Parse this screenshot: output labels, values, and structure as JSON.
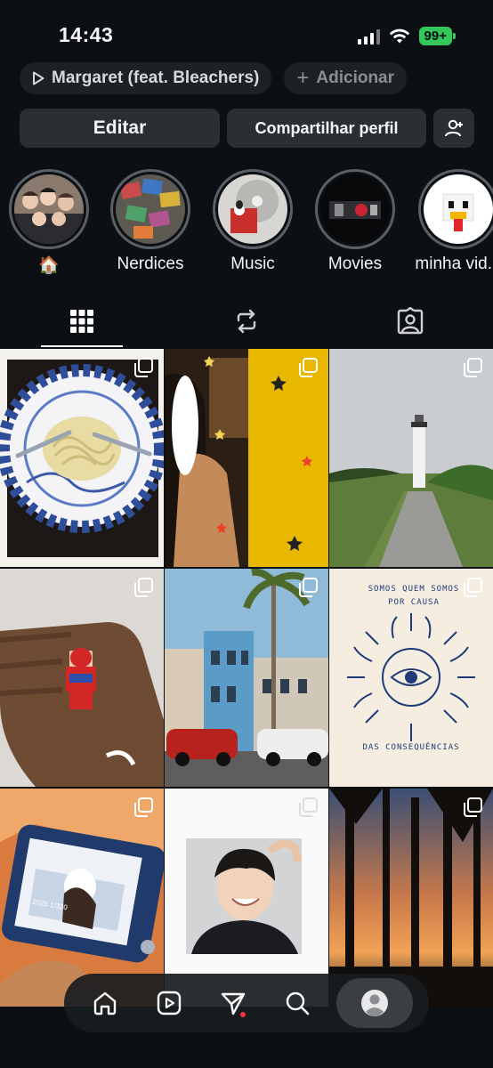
{
  "status_bar": {
    "time": "14:43",
    "battery": "99+"
  },
  "music_chip": {
    "label": "Margaret (feat. Bleachers)"
  },
  "add_chip": {
    "label": "Adicionar"
  },
  "buttons": {
    "edit": "Editar",
    "share": "Compartilhar perfil"
  },
  "highlights": [
    {
      "label": "🏠"
    },
    {
      "label": "Nerdices"
    },
    {
      "label": "Music"
    },
    {
      "label": "Movies"
    },
    {
      "label": "minha vid..."
    }
  ],
  "tabs": [
    "grid-icon",
    "reposts-icon",
    "tagged-icon"
  ],
  "posts": [
    {
      "text": ""
    },
    {
      "text": ""
    },
    {
      "text": ""
    },
    {
      "text": ""
    },
    {
      "text": ""
    },
    {
      "text": "SOMOS QUEM SOMOS POR CAUSA",
      "text2": "DAS CONSEQUÊNCIAS"
    },
    {
      "text": "2025 1/320"
    },
    {
      "text": ""
    },
    {
      "text": ""
    }
  ],
  "nav": [
    "home-icon",
    "reels-icon",
    "direct-icon",
    "search-icon",
    "profile-icon"
  ],
  "colors": {
    "background": "#0c1014",
    "button": "#2a2f34",
    "battery": "#34c759",
    "notification": "#ff3040"
  }
}
